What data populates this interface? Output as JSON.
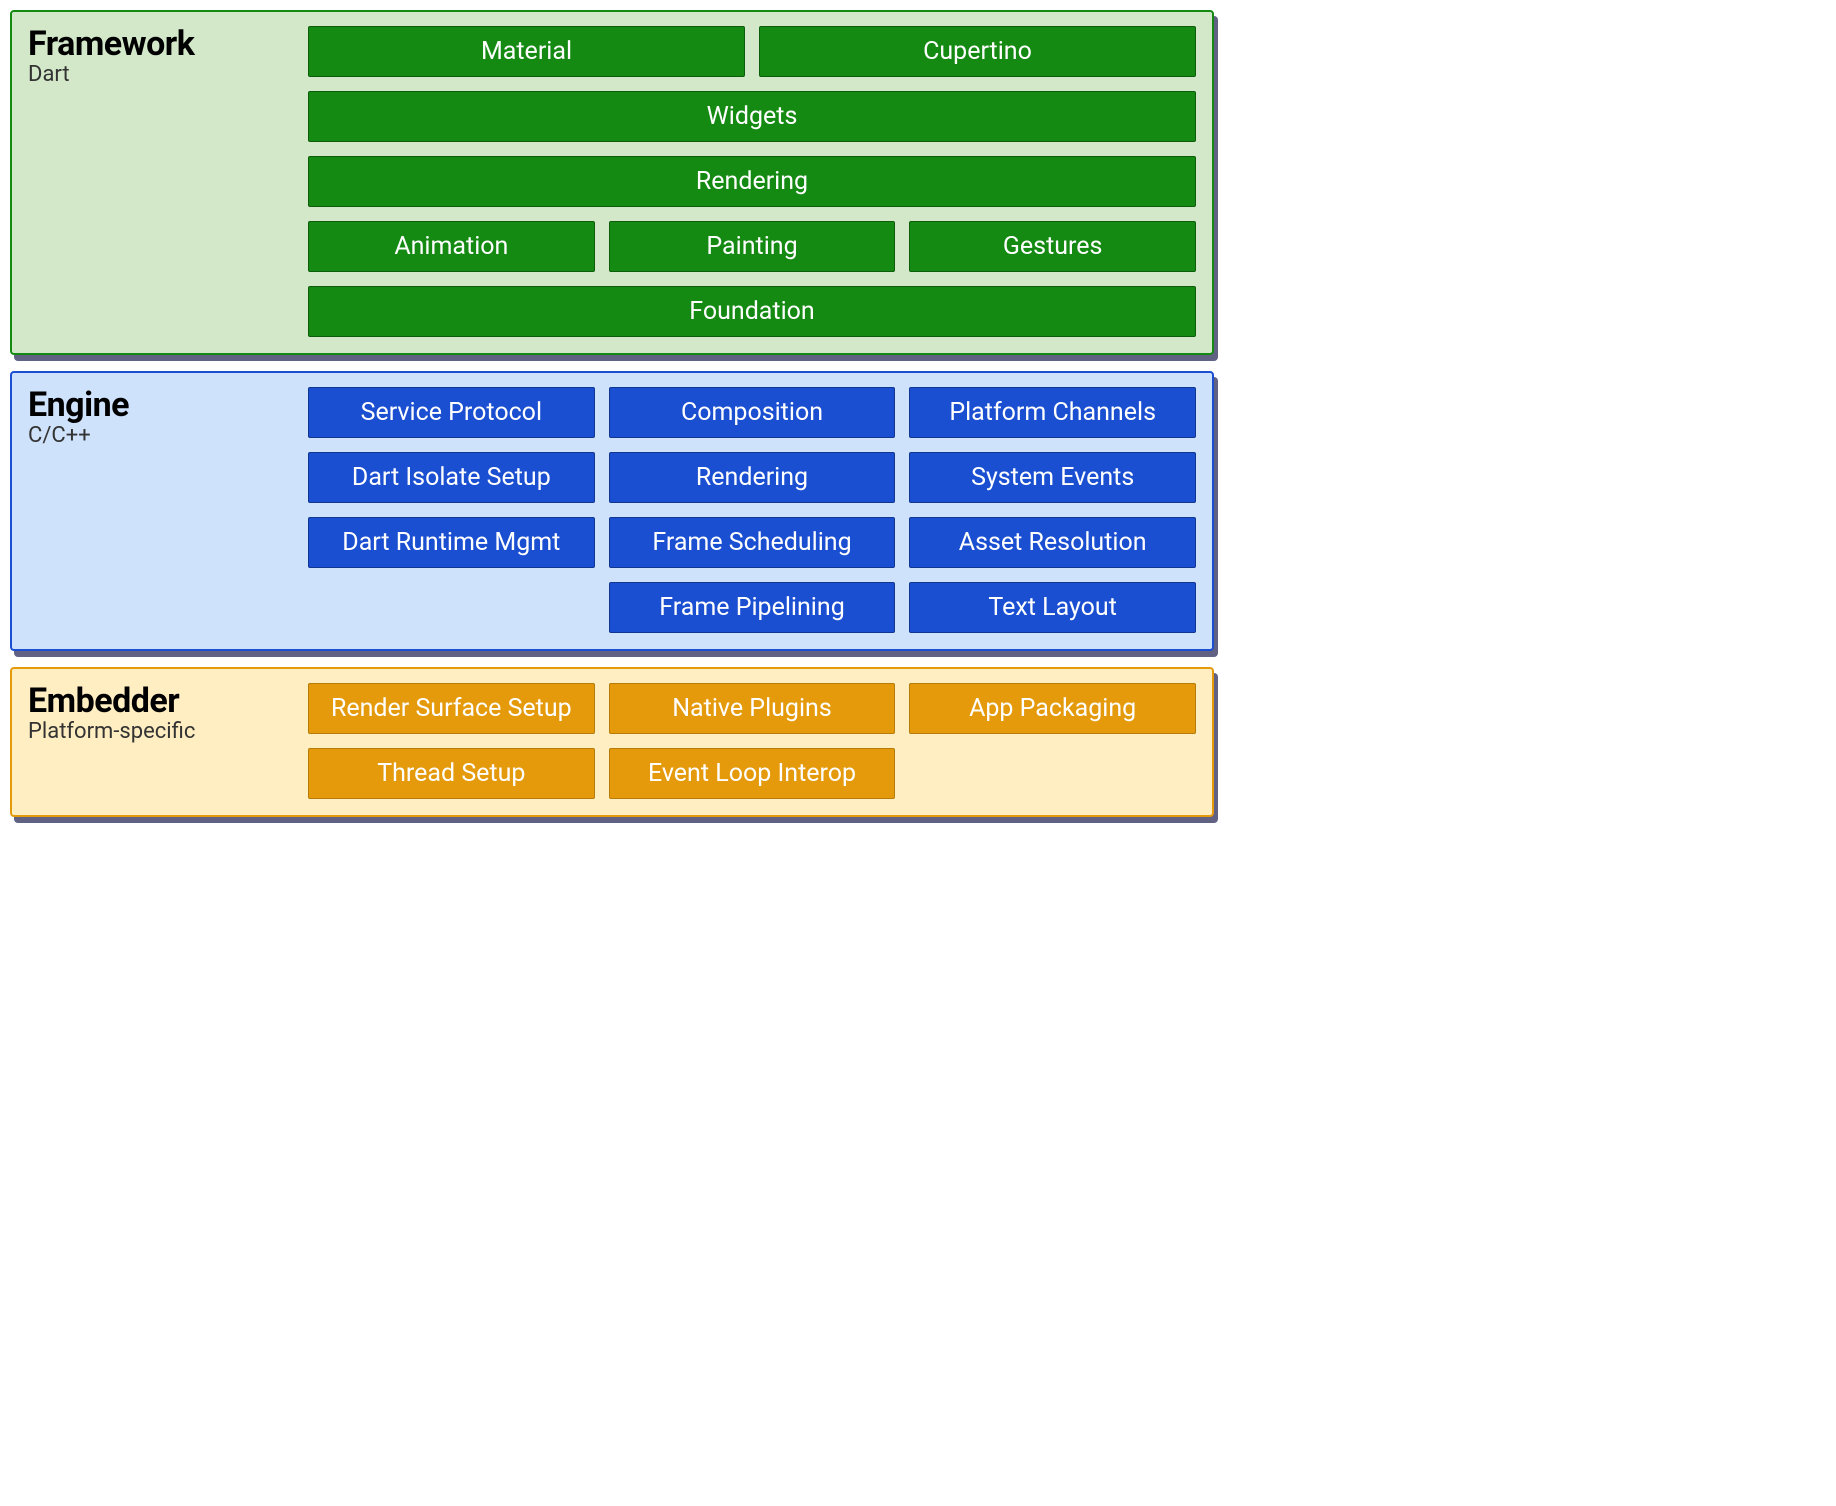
{
  "framework": {
    "title": "Framework",
    "subtitle": "Dart",
    "rows": [
      [
        "Material",
        "Cupertino"
      ],
      [
        "Widgets"
      ],
      [
        "Rendering"
      ],
      [
        "Animation",
        "Painting",
        "Gestures"
      ],
      [
        "Foundation"
      ]
    ]
  },
  "engine": {
    "title": "Engine",
    "subtitle": "C/C++",
    "grid": [
      "Service Protocol",
      "Composition",
      "Platform Channels",
      "Dart Isolate Setup",
      "Rendering",
      "System Events",
      "Dart Runtime Mgmt",
      "Frame Scheduling",
      "Asset Resolution",
      "",
      "Frame Pipelining",
      "Text Layout"
    ]
  },
  "embedder": {
    "title": "Embedder",
    "subtitle": "Platform-specific",
    "grid": [
      "Render Surface Setup",
      "Native Plugins",
      "App Packaging",
      "Thread Setup",
      "Event Loop Interop",
      ""
    ]
  }
}
